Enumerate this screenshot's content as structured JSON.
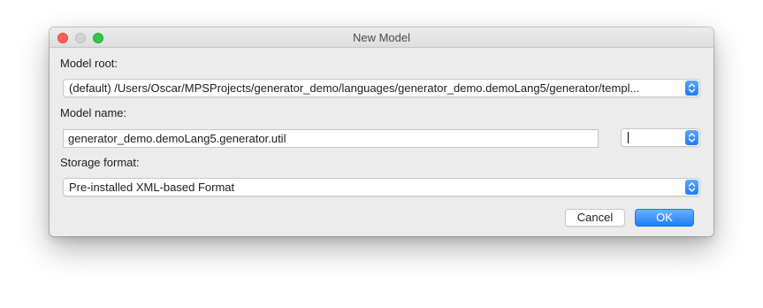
{
  "window": {
    "title": "New Model"
  },
  "form": {
    "model_root": {
      "label": "Model root:",
      "value": "(default) /Users/Oscar/MPSProjects/generator_demo/languages/generator_demo.demoLang5/generator/templ..."
    },
    "model_name": {
      "label": "Model name:",
      "value": "generator_demo.demoLang5.generator.util",
      "stereotype_value": ""
    },
    "storage_format": {
      "label": "Storage format:",
      "value": "Pre-installed XML-based Format"
    }
  },
  "buttons": {
    "cancel_label": "Cancel",
    "ok_label": "OK"
  },
  "colors": {
    "accent": "#1f7cf5",
    "close": "#fc5f57",
    "minimize_inactive": "#d4d4d4",
    "maximize": "#33c748",
    "window_bg": "#ececec"
  },
  "icons": {
    "combo_stepper": "up-down-chevron-icon"
  }
}
